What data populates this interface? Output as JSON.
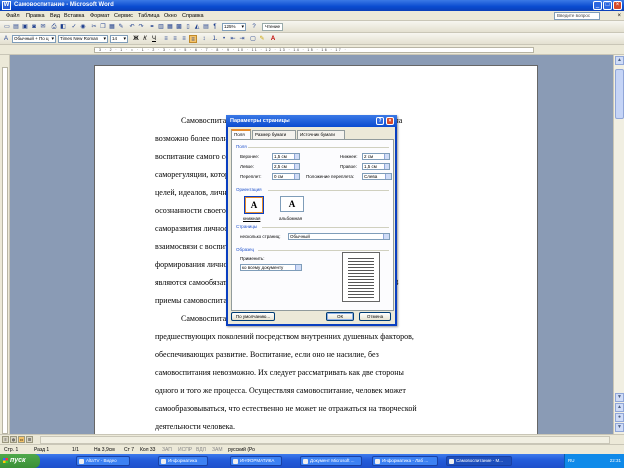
{
  "window": {
    "title": "Самовоспитание - Microsoft Word",
    "minimize": "_",
    "maximize": "□",
    "close": "×"
  },
  "menu": {
    "items": [
      "Файл",
      "Правка",
      "Вид",
      "Вставка",
      "Формат",
      "Сервис",
      "Таблица",
      "Окно",
      "Справка"
    ],
    "help_placeholder": "Введите вопрос",
    "close": "×"
  },
  "toolbar1": {
    "zoom": "125%",
    "reading_button": "Чтение"
  },
  "toolbar2": {
    "style": "Обычный + По ц",
    "font": "Times New Roman",
    "size": "14",
    "bold": "Ж",
    "italic": "К",
    "underline": "Ч"
  },
  "ruler": {
    "numbers": "· 3 · 2 · 1 · ⌂ · 1 · 2 · 3 · 4 · 5 · 6 · 7 · 8 · 9 · 10 · 11 · 12 · 13 · 14 · 15 · 16 · 17 ·"
  },
  "document": {
    "lines": [
      "Самовоспитание — сознательная деятельность, направленная на",
      "возможно более полную реализацию человеком себя как личности,",
      "воспитание самого себя в направлении активизации механизмов",
      "саморегуляции, которые предполагают наличие ясно осознанных",
      "целей, идеалов, личностных смыслов. Для повышения степени",
      "осознанности своего поведения оно является значительной силой",
      "саморазвития личности. Самовоспитание находится в неразрывной",
      "взаимосвязи с воспитанием, обогащая, дополняя и развивая процесс",
      "формирования личности. Основными инструментами самовоспитания",
      "являются самообязательство, самоотчет, самоанализ и самоконтроль. В",
      "приемы самовоспитания входят: самоубеждение, самовнушение.",
      "Самовоспитание — это усвоение человеком опыта",
      "предшествующих поколений посредством внутренних душевных факторов,",
      "обеспечивающих развитие. Воспитание, если оно не насилие, без",
      "самовоспитания невозможно. Их следует рассматривать как две стороны",
      "одного и того же процесса. Осуществляя самовоспитание, человек может",
      "самообразовываться, что естественно не может не отражаться на творческой",
      "деятельности человека."
    ]
  },
  "dialog": {
    "title": "Параметры страницы",
    "help": "?",
    "close": "×",
    "tabs": [
      "Поля",
      "Размер бумаги",
      "Источник бумаги"
    ],
    "margins_group": "Поля",
    "top_label": "Верхнее:",
    "top_value": "1,5 см",
    "bottom_label": "Нижнее:",
    "bottom_value": "2 см",
    "left_label": "Левое:",
    "left_value": "2,5 см",
    "right_label": "Правое:",
    "right_value": "1,5 см",
    "gutter_label": "Переплет:",
    "gutter_value": "0 см",
    "gutter_pos_label": "Положение переплета:",
    "gutter_pos_value": "Слева",
    "orientation_group": "Ориентация",
    "portrait_label": "книжная",
    "landscape_label": "альбомная",
    "orientation_glyph": "A",
    "pages_group": "Страницы",
    "multiple_pages_label": "несколько страниц:",
    "multiple_pages_value": "Обычный",
    "sample_group": "Образец",
    "apply_label": "Применить:",
    "apply_value": "ко всему документу",
    "default_button": "По умолчанию...",
    "ok_button": "ОК",
    "cancel_button": "Отмена"
  },
  "status": {
    "page": "Стр. 1",
    "section": "Разд 1",
    "pages": "1/1",
    "position": "На 3,9см",
    "line": "Ст 7",
    "column": "Кол 33",
    "modes": [
      "ЗАП",
      "ИСПР",
      "ВДЛ",
      "ЗАМ"
    ],
    "language": "русский (Ро"
  },
  "taskbar": {
    "start": "пуск",
    "tasks": [
      "AltaTV - Видео",
      "Информатика",
      "ИНФОРМАТИКА",
      "Документ Microsoft ...",
      "Информатика - Лаб ...",
      "Самовоспитание - М..."
    ],
    "lang": "RU",
    "clock": "22:31"
  }
}
